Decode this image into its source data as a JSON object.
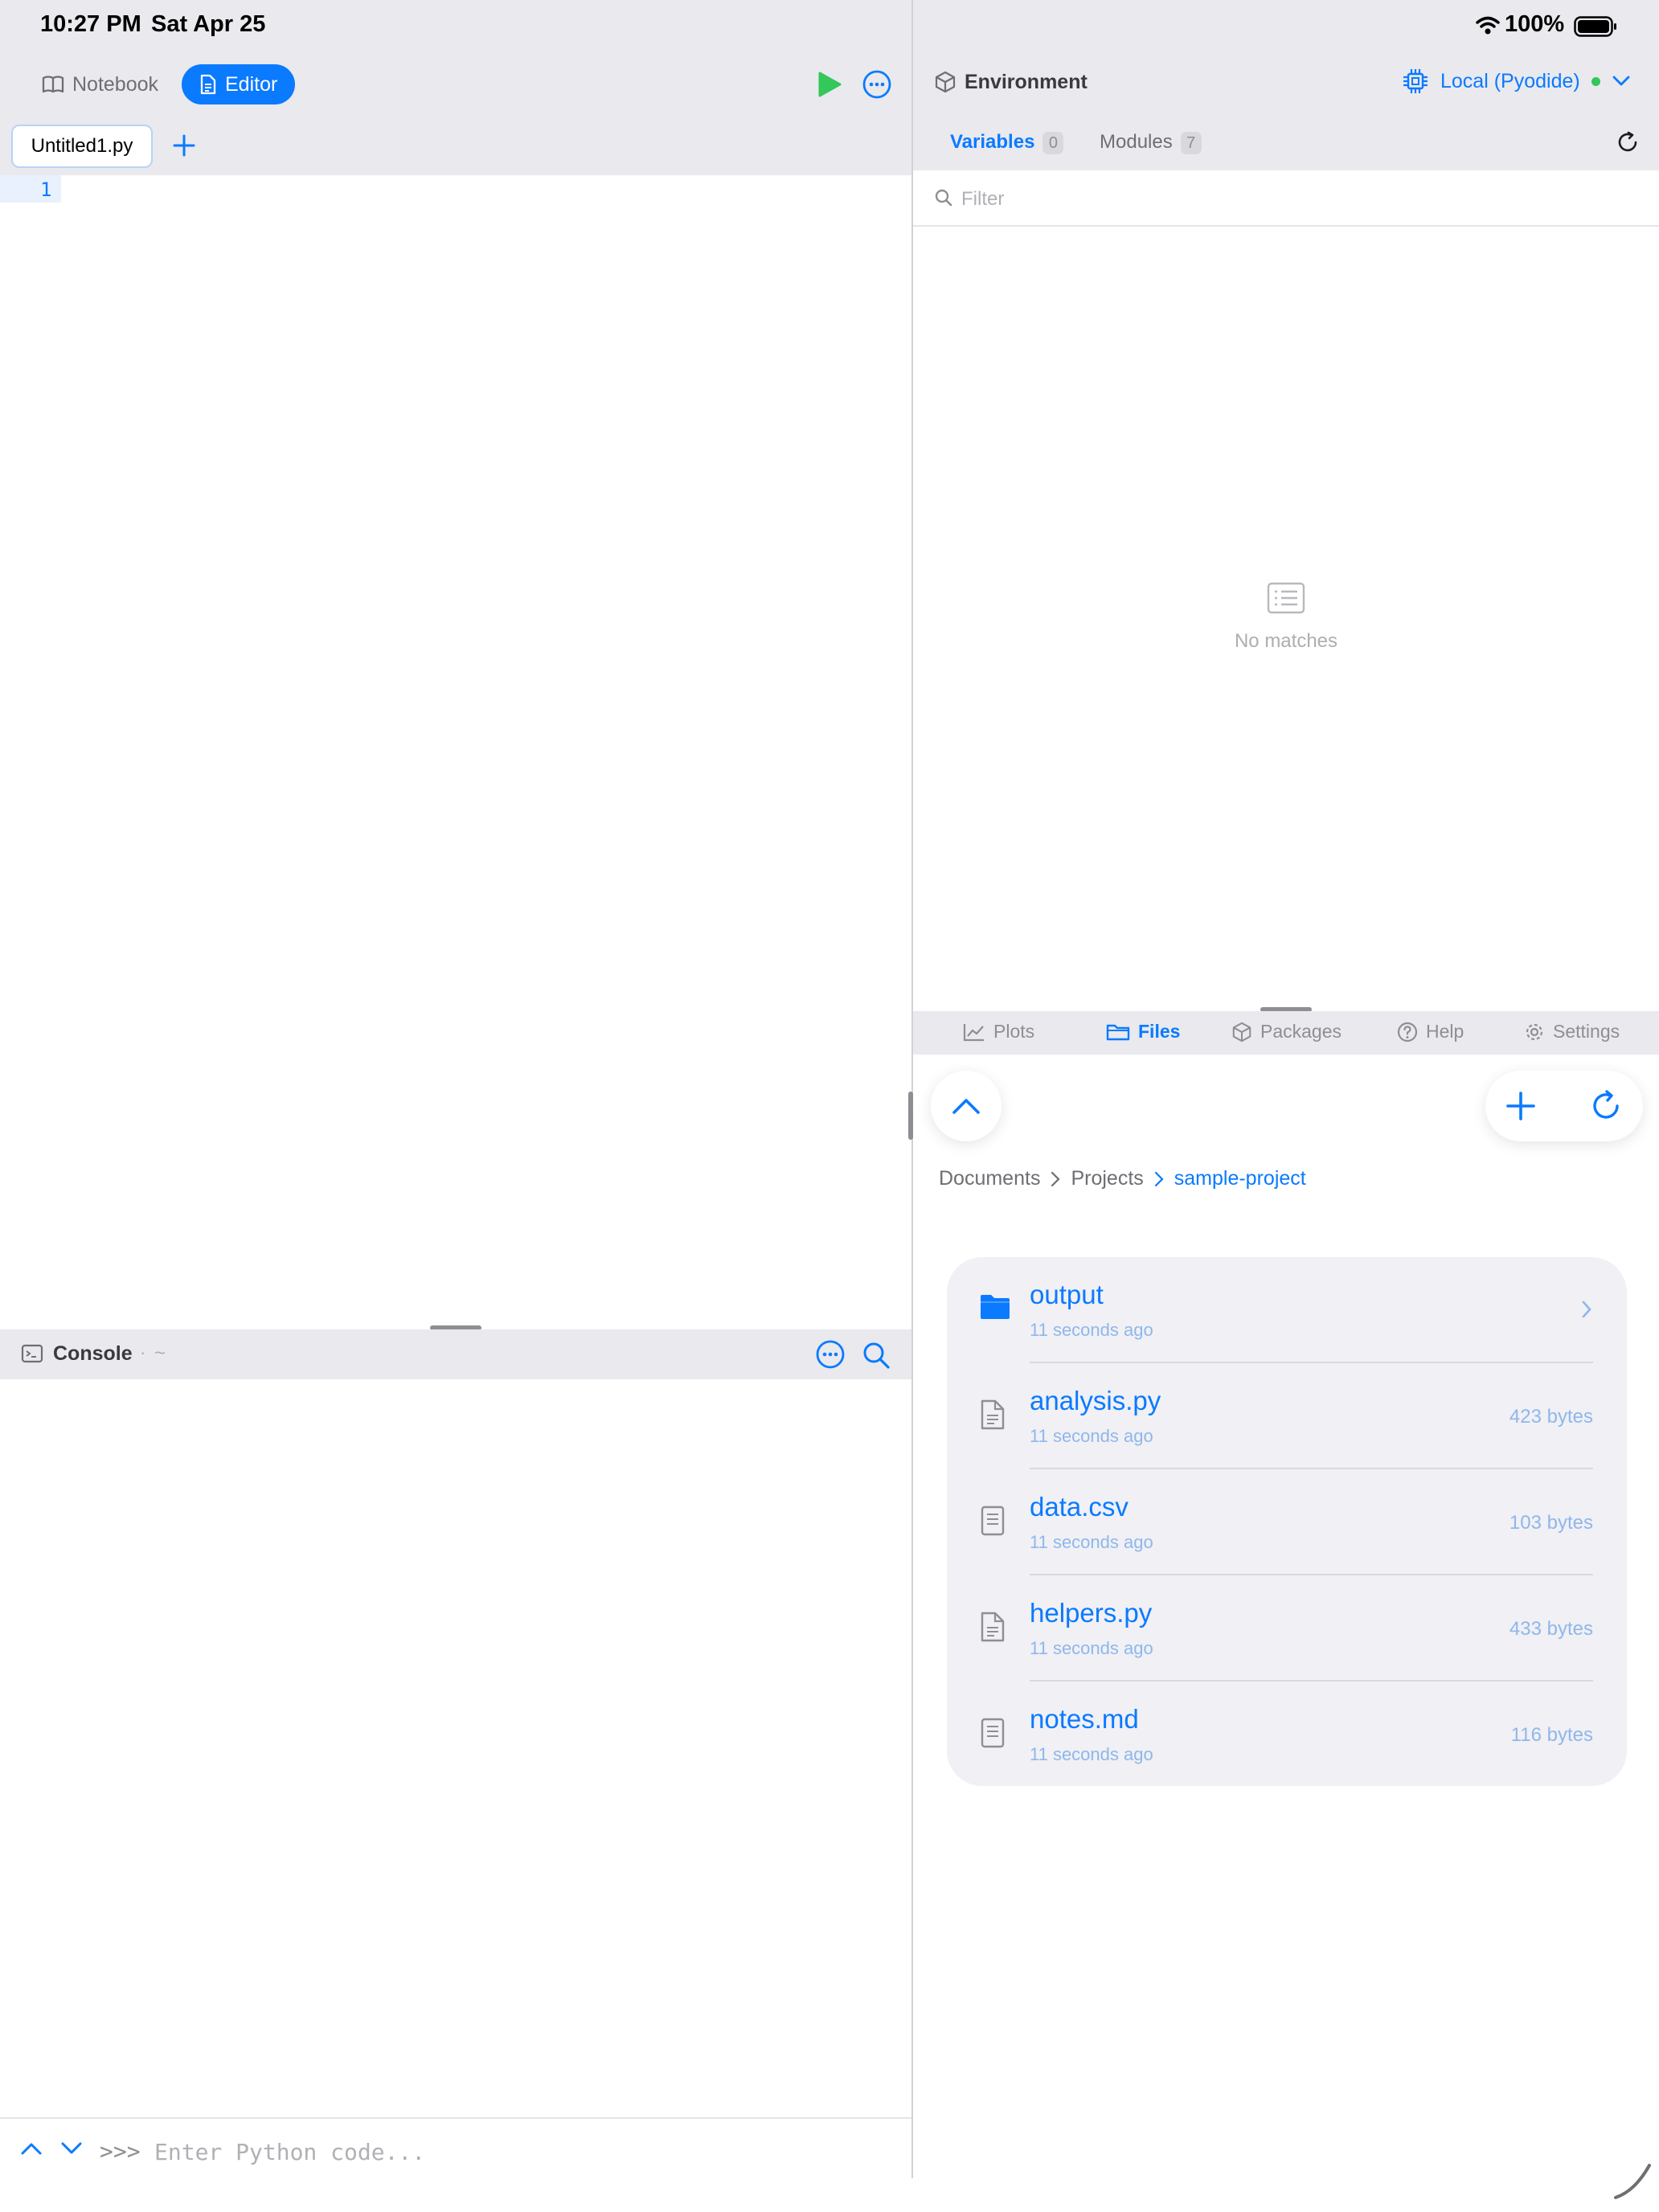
{
  "status_bar": {
    "time": "10:27 PM",
    "date": "Sat Apr 25",
    "battery": "100%"
  },
  "left_toolbar": {
    "notebook_label": "Notebook",
    "editor_label": "Editor"
  },
  "editor": {
    "tab_title": "Untitled1.py",
    "line_numbers": [
      "1"
    ]
  },
  "console": {
    "title": "Console",
    "separator": "·",
    "path": "~",
    "prompt": ">>>",
    "input_placeholder": "Enter Python code..."
  },
  "environment": {
    "title": "Environment",
    "runtime": "Local (Pyodide)",
    "tabs": [
      {
        "label": "Variables",
        "count": "0"
      },
      {
        "label": "Modules",
        "count": "7"
      }
    ],
    "filter_placeholder": "Filter",
    "empty_text": "No matches"
  },
  "lower_tabs": [
    {
      "label": "Plots"
    },
    {
      "label": "Files"
    },
    {
      "label": "Packages"
    },
    {
      "label": "Help"
    },
    {
      "label": "Settings"
    }
  ],
  "files": {
    "breadcrumb": [
      "Documents",
      "Projects",
      "sample-project"
    ],
    "items": [
      {
        "name": "output",
        "modified": "11 seconds ago",
        "size": "",
        "icon": "folder-icon"
      },
      {
        "name": "analysis.py",
        "modified": "11 seconds ago",
        "size": "423 bytes",
        "icon": "python-file-icon"
      },
      {
        "name": "data.csv",
        "modified": "11 seconds ago",
        "size": "103 bytes",
        "icon": "text-file-icon"
      },
      {
        "name": "helpers.py",
        "modified": "11 seconds ago",
        "size": "433 bytes",
        "icon": "python-file-icon"
      },
      {
        "name": "notes.md",
        "modified": "11 seconds ago",
        "size": "116 bytes",
        "icon": "text-file-icon"
      }
    ]
  },
  "colors": {
    "accent": "#0a7aff",
    "run": "#34c759",
    "status_dot": "#34c759",
    "chrome": "#e9e9ee"
  }
}
